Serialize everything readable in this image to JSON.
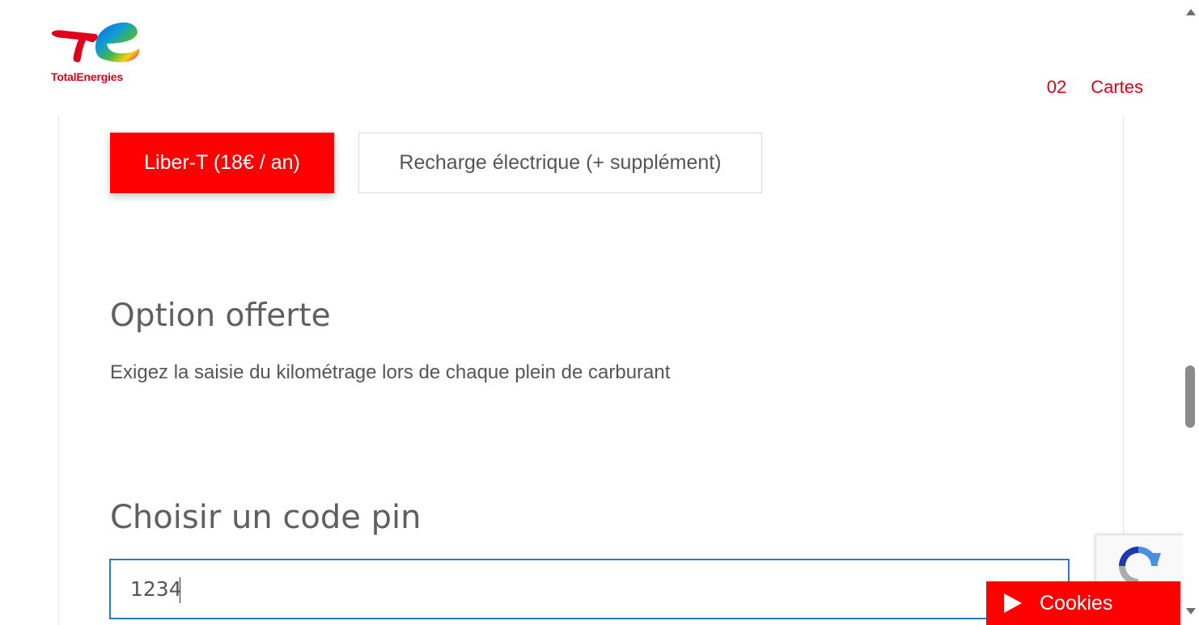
{
  "brand": {
    "name": "TotalEnergies",
    "color": "#e0001a"
  },
  "nav": {
    "items": [
      "02",
      "Cartes"
    ]
  },
  "options": {
    "primary_label": "Liber-T (18€ / an)",
    "secondary_label": "Recharge électrique (+ supplément)"
  },
  "option_offerte": {
    "title": "Option offerte",
    "description": "Exigez la saisie du kilométrage lors de chaque plein de carburant"
  },
  "pin": {
    "title": "Choisir un code pin",
    "value": "1234"
  },
  "cookies": {
    "label": "Cookies"
  },
  "colors": {
    "accent": "#ff0000",
    "input_focus": "#3178c6",
    "text": "#5f5f5f"
  }
}
